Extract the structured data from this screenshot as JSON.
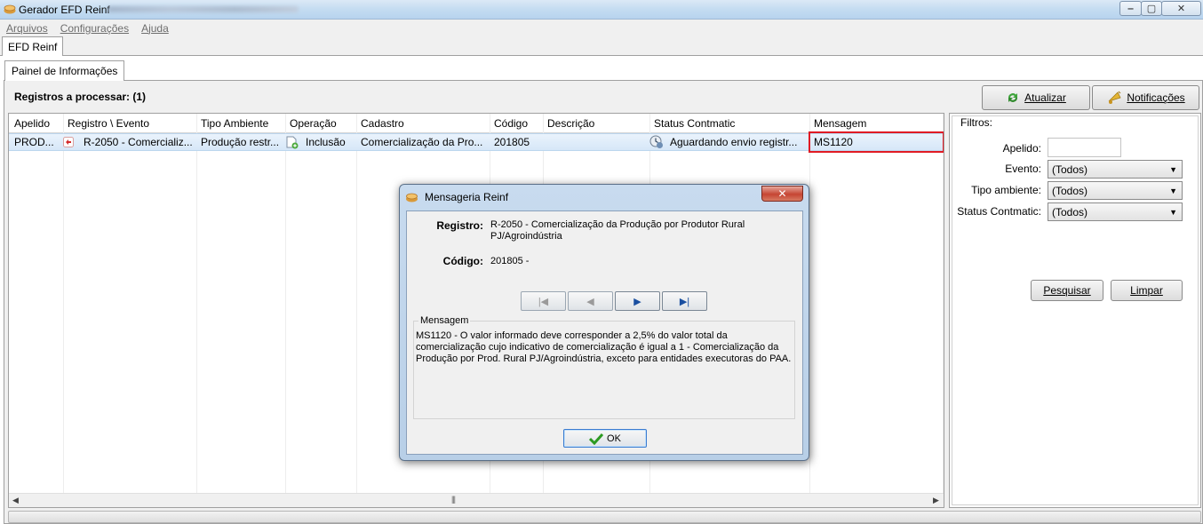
{
  "window": {
    "title": "Gerador EFD Reinf",
    "buttons": {
      "minimize": "‒",
      "maximize": "▢",
      "close": "✕"
    }
  },
  "menu": {
    "items": [
      "Arquivos",
      "Configurações",
      "Ajuda"
    ]
  },
  "outer_tab": "EFD Reinf",
  "inner_tab": "Painel de Informações",
  "registros_label": "Registros a processar: (1)",
  "toolbar": {
    "atualizar": "Atualizar",
    "notificacoes": "Notificações"
  },
  "grid": {
    "columns": [
      "Apelido",
      "Registro \\ Evento",
      "Tipo Ambiente",
      "Operação",
      "Cadastro",
      "Código",
      "Descrição",
      "Status Contmatic",
      "Mensagem"
    ],
    "rows": [
      {
        "apelido": "PROD...",
        "registro": "R-2050 - Comercializ...",
        "tipo_ambiente": "Produção restr...",
        "operacao": "Inclusão",
        "cadastro": "Comercialização da Pro...",
        "codigo": "201805",
        "descricao": "",
        "status": "Aguardando envio registr...",
        "mensagem": "MS1120"
      }
    ],
    "highlight_color": "#e01b24"
  },
  "filters": {
    "title": "Filtros:",
    "apelido_label": "Apelido:",
    "apelido_value": "",
    "evento_label": "Evento:",
    "evento_value": "(Todos)",
    "tipo_ambiente_label": "Tipo ambiente:",
    "tipo_ambiente_value": "(Todos)",
    "status_label": "Status Contmatic:",
    "status_value": "(Todos)",
    "pesquisar": "Pesquisar",
    "limpar": "Limpar"
  },
  "dialog": {
    "title": "Mensageria Reinf",
    "close": "✕",
    "registro_label": "Registro:",
    "registro_value_line1": "R-2050 - Comercialização da Produção por Produtor Rural",
    "registro_value_line2": "PJ/Agroindústria",
    "codigo_label": "Código:",
    "codigo_value": "201805 -",
    "nav": {
      "first": "|◀",
      "prev": "◀",
      "next": "▶",
      "last": "▶|"
    },
    "mensagem_legend": "Mensagem",
    "mensagem_text": "MS1120 - O valor informado deve corresponder a 2,5% do valor total da comercialização cujo indicativo de comercialização é igual a 1 - Comercialização da Produção por Prod. Rural PJ/Agroindústria, exceto para entidades executoras do PAA.",
    "ok": "OK"
  }
}
